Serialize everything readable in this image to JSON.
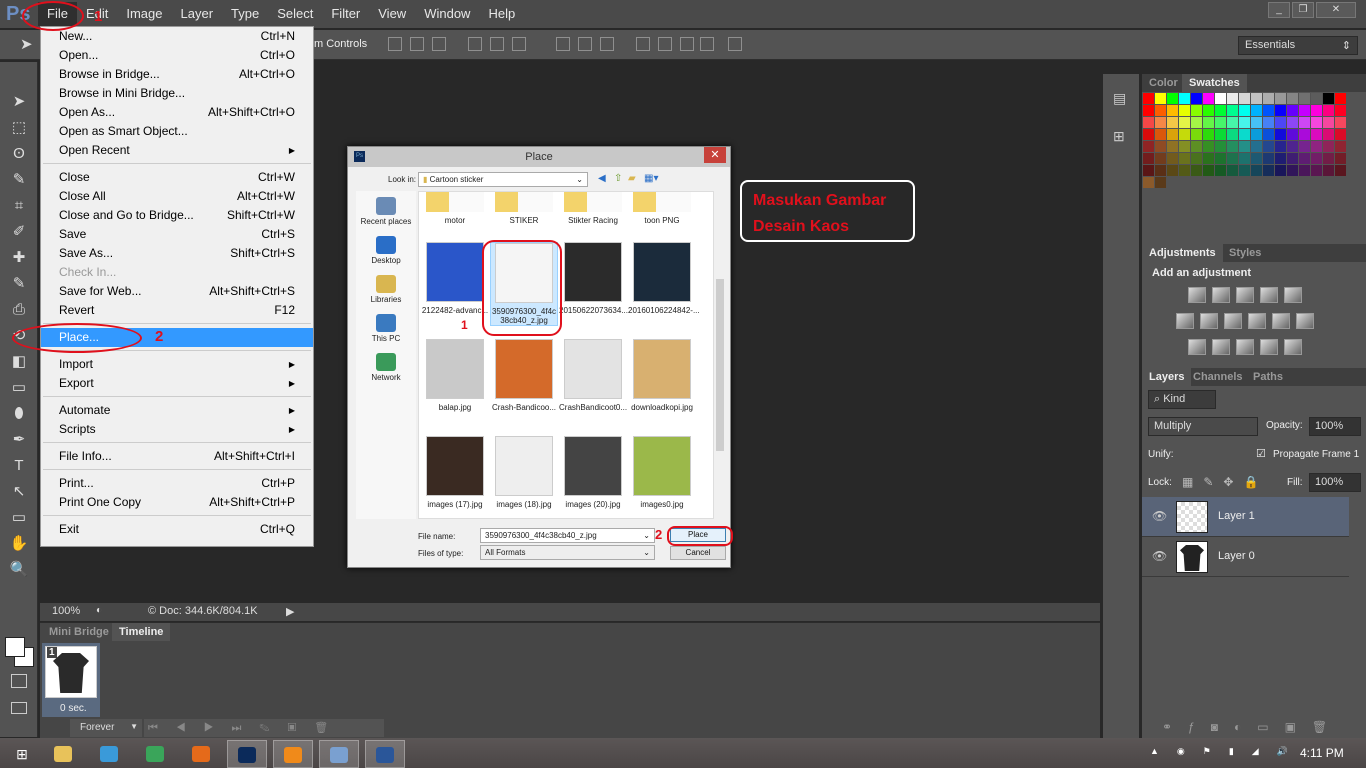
{
  "menubar": {
    "logo": "Ps",
    "items": [
      "File",
      "Edit",
      "Image",
      "Layer",
      "Type",
      "Select",
      "Filter",
      "View",
      "Window",
      "Help"
    ]
  },
  "options": {
    "controls_label": "m Controls",
    "workspace": "Essentials"
  },
  "file_menu": [
    {
      "label": "New...",
      "shortcut": "Ctrl+N"
    },
    {
      "label": "Open...",
      "shortcut": "Ctrl+O"
    },
    {
      "label": "Browse in Bridge...",
      "shortcut": "Alt+Ctrl+O"
    },
    {
      "label": "Browse in Mini Bridge...",
      "shortcut": ""
    },
    {
      "label": "Open As...",
      "shortcut": "Alt+Shift+Ctrl+O"
    },
    {
      "label": "Open as Smart Object...",
      "shortcut": ""
    },
    {
      "label": "Open Recent",
      "shortcut": "",
      "submenu": true
    },
    {
      "sep": true
    },
    {
      "label": "Close",
      "shortcut": "Ctrl+W"
    },
    {
      "label": "Close All",
      "shortcut": "Alt+Ctrl+W"
    },
    {
      "label": "Close and Go to Bridge...",
      "shortcut": "Shift+Ctrl+W"
    },
    {
      "label": "Save",
      "shortcut": "Ctrl+S"
    },
    {
      "label": "Save As...",
      "shortcut": "Shift+Ctrl+S"
    },
    {
      "label": "Check In...",
      "shortcut": "",
      "disabled": true
    },
    {
      "label": "Save for Web...",
      "shortcut": "Alt+Shift+Ctrl+S"
    },
    {
      "label": "Revert",
      "shortcut": "F12"
    },
    {
      "sep": true
    },
    {
      "label": "Place...",
      "shortcut": "",
      "highlighted": true
    },
    {
      "sep": true
    },
    {
      "label": "Import",
      "shortcut": "",
      "submenu": true
    },
    {
      "label": "Export",
      "shortcut": "",
      "submenu": true
    },
    {
      "sep": true
    },
    {
      "label": "Automate",
      "shortcut": "",
      "submenu": true
    },
    {
      "label": "Scripts",
      "shortcut": "",
      "submenu": true
    },
    {
      "sep": true
    },
    {
      "label": "File Info...",
      "shortcut": "Alt+Shift+Ctrl+I"
    },
    {
      "sep": true
    },
    {
      "label": "Print...",
      "shortcut": "Ctrl+P"
    },
    {
      "label": "Print One Copy",
      "shortcut": "Alt+Shift+Ctrl+P"
    },
    {
      "sep": true
    },
    {
      "label": "Exit",
      "shortcut": "Ctrl+Q"
    }
  ],
  "dialog": {
    "title": "Place",
    "look_in_label": "Look in:",
    "look_in": "Cartoon sticker",
    "places": [
      "Recent places",
      "Desktop",
      "Libraries",
      "This PC",
      "Network"
    ],
    "files": [
      {
        "name": "motor",
        "type": "folder"
      },
      {
        "name": "STIKER",
        "type": "folder"
      },
      {
        "name": "Stikter Racing",
        "type": "folder"
      },
      {
        "name": "toon PNG",
        "type": "folder"
      },
      {
        "name": "2122482-advanc...",
        "color": "#2a56c9"
      },
      {
        "name": "3590976300_4f4c38cb40_z.jpg",
        "color": "#f5f5f5",
        "selected": true
      },
      {
        "name": "20150622073634....",
        "color": "#2b2b2b"
      },
      {
        "name": "20160106224842-...",
        "color": "#1b2b3b"
      },
      {
        "name": "balap.jpg",
        "color": "#c9c9c9"
      },
      {
        "name": "Crash-Bandicoo...",
        "color": "#d46a2a"
      },
      {
        "name": "CrashBandicoot0...",
        "color": "#e3e3e3"
      },
      {
        "name": "downloadkopi.jpg",
        "color": "#d8b070"
      },
      {
        "name": "images (17).jpg",
        "color": "#3a2a22"
      },
      {
        "name": "images (18).jpg",
        "color": "#eeeeee"
      },
      {
        "name": "images (20).jpg",
        "color": "#444444"
      },
      {
        "name": "images0.jpg",
        "color": "#9bb84a"
      }
    ],
    "file_name_label": "File name:",
    "file_name": "3590976300_4f4c38cb40_z.jpg",
    "file_type_label": "Files of type:",
    "file_type": "All Formats",
    "place_button": "Place",
    "cancel_button": "Cancel"
  },
  "annotations": {
    "step1": "1",
    "step2": "2",
    "callout": "Masukan Gambar Desain Kaos"
  },
  "status": {
    "zoom": "100%",
    "doc": "© Doc: 344.6K/804.1K"
  },
  "timeline": {
    "tabs": [
      "Mini Bridge",
      "Timeline"
    ],
    "frame_number": "1",
    "frame_delay": "0 sec.",
    "loop": "Forever"
  },
  "panels": {
    "color_tabs": [
      "Color",
      "Swatches"
    ],
    "swatch_top_row": [
      "#ff0000",
      "#ffff00",
      "#00ff00",
      "#00ffff",
      "#0000ff",
      "#ff00ff",
      "#ffffff",
      "#ebebeb",
      "#d6d6d6",
      "#c2c2c2",
      "#adadad",
      "#999999",
      "#858585",
      "#707070",
      "#5c5c5c",
      "#000000",
      "#ff0000"
    ],
    "adj_tabs": [
      "Adjustments",
      "Styles"
    ],
    "adj_heading": "Add an adjustment",
    "layers_tabs": [
      "Layers",
      "Channels",
      "Paths"
    ],
    "filter_kind": "Kind",
    "blend_mode": "Multiply",
    "opacity_label": "Opacity:",
    "opacity": "100%",
    "unify_label": "Unify:",
    "propagate_label": "Propagate Frame 1",
    "lock_label": "Lock:",
    "fill_label": "Fill:",
    "fill": "100%",
    "layers": [
      {
        "name": "Layer 1",
        "selected": true
      },
      {
        "name": "Layer 0",
        "selected": false
      }
    ]
  },
  "taskbar": {
    "apps": [
      "file-explorer",
      "internet-explorer",
      "chrome",
      "firefox",
      "photoshop",
      "media-player",
      "paint",
      "word"
    ],
    "clock": "4:11 PM"
  }
}
